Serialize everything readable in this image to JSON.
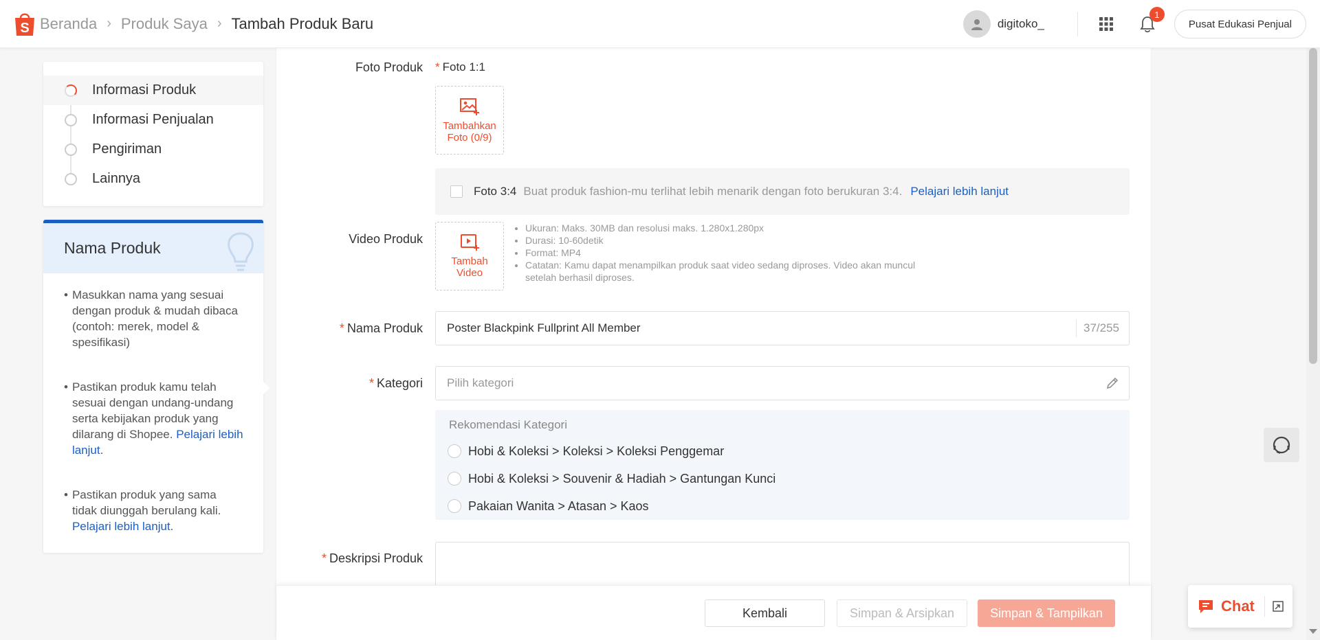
{
  "header": {
    "breadcrumb": [
      "Beranda",
      "Produk Saya",
      "Tambah Produk Baru"
    ],
    "username": "digitoko_",
    "notification_count": "1",
    "edu_button": "Pusat Edukasi Penjual"
  },
  "steps": [
    {
      "label": "Informasi Produk",
      "active": true
    },
    {
      "label": "Informasi Penjualan",
      "active": false
    },
    {
      "label": "Pengiriman",
      "active": false
    },
    {
      "label": "Lainnya",
      "active": false
    }
  ],
  "tips": {
    "title": "Nama Produk",
    "items": [
      {
        "text": "Masukkan nama yang sesuai dengan produk & mudah dibaca (contoh: merek, model & spesifikasi)"
      },
      {
        "text": "Pastikan produk kamu telah sesuai dengan undang-undang serta kebijakan produk yang dilarang di Shopee. ",
        "link": "Pelajari lebih lanjut",
        "suffix": "."
      },
      {
        "text": "Pastikan produk yang sama tidak diunggah berulang kali. ",
        "link": "Pelajari lebih lanjut",
        "suffix": "."
      }
    ]
  },
  "form": {
    "foto": {
      "label": "Foto Produk",
      "sub_label": "Foto 1:1",
      "upload_label": "Tambahkan Foto (0/9)",
      "foto34_title": "Foto 3:4",
      "foto34_desc": "Buat produk fashion-mu terlihat lebih menarik dengan foto berukuran 3:4.",
      "foto34_link": "Pelajari lebih lanjut"
    },
    "video": {
      "label": "Video Produk",
      "upload_label": "Tambah Video",
      "notes": [
        "Ukuran: Maks. 30MB dan resolusi maks. 1.280x1.280px",
        "Durasi: 10-60detik",
        "Format: MP4",
        "Catatan: Kamu dapat menampilkan produk saat video sedang diproses. Video akan muncul setelah berhasil diproses."
      ]
    },
    "nama": {
      "label": "Nama Produk",
      "value": "Poster Blackpink Fullprint All Member",
      "counter": "37/255"
    },
    "kategori": {
      "label": "Kategori",
      "placeholder": "Pilih kategori",
      "rec_title": "Rekomendasi Kategori",
      "recommendations": [
        "Hobi & Koleksi > Koleksi > Koleksi Penggemar",
        "Hobi & Koleksi > Souvenir & Hadiah > Gantungan Kunci",
        "Pakaian Wanita > Atasan > Kaos"
      ]
    },
    "deskripsi": {
      "label": "Deskripsi Produk"
    }
  },
  "actions": {
    "back": "Kembali",
    "archive": "Simpan & Arsipkan",
    "save": "Simpan & Tampilkan"
  },
  "chat": {
    "label": "Chat"
  },
  "colors": {
    "brand": "#ee4d2d",
    "link": "#1a5fc6"
  }
}
